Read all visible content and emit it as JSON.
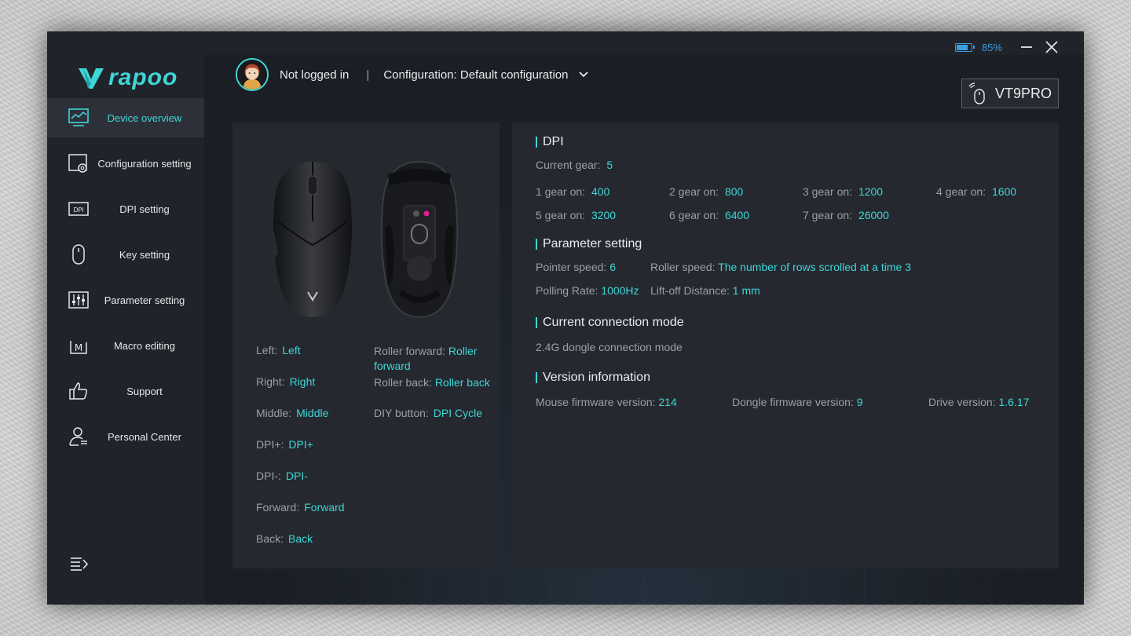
{
  "app": {
    "logo_text": "rapoo",
    "battery": "85%",
    "battery_level": 0.85,
    "accent_color": "#3ed6d6"
  },
  "sidebar": {
    "items": [
      {
        "label": "Device overview",
        "icon": "monitor-chart-icon",
        "active": true
      },
      {
        "label": "Configuration setting",
        "icon": "config-gear-icon"
      },
      {
        "label": "DPI setting",
        "icon": "dpi-icon"
      },
      {
        "label": "Key setting",
        "icon": "mouse-icon"
      },
      {
        "label": "Parameter setting",
        "icon": "sliders-icon"
      },
      {
        "label": "Macro editing",
        "icon": "macro-icon"
      },
      {
        "label": "Support",
        "icon": "thumbs-up-icon"
      },
      {
        "label": "Personal Center",
        "icon": "user-icon"
      }
    ]
  },
  "header": {
    "user_status": "Not logged in",
    "separator": "|",
    "configuration": "Configuration: Default configuration",
    "device_name": "VT9PRO"
  },
  "keys": {
    "left": {
      "label": "Left:",
      "value": "Left"
    },
    "right": {
      "label": "Right:",
      "value": "Right"
    },
    "middle": {
      "label": "Middle:",
      "value": "Middle"
    },
    "dpi_plus": {
      "label": "DPI+:",
      "value": "DPI+"
    },
    "dpi_minus": {
      "label": "DPI-:",
      "value": "DPI-"
    },
    "forward": {
      "label": "Forward:",
      "value": "Forward"
    },
    "back": {
      "label": "Back:",
      "value": "Back"
    },
    "roller_forward": {
      "label": "Roller forward:",
      "value": "Roller forward"
    },
    "roller_back": {
      "label": "Roller back:",
      "value": "Roller back"
    },
    "diy_button": {
      "label": "DIY button:",
      "value": "DPI Cycle"
    }
  },
  "dpi": {
    "title": "DPI",
    "current_gear_label": "Current gear:",
    "current_gear": "5",
    "gears": [
      {
        "label": "1 gear on:",
        "value": "400"
      },
      {
        "label": "2 gear on:",
        "value": "800"
      },
      {
        "label": "3 gear on:",
        "value": "1200"
      },
      {
        "label": "4 gear on:",
        "value": "1600"
      },
      {
        "label": "5 gear on:",
        "value": "3200"
      },
      {
        "label": "6 gear on:",
        "value": "6400"
      },
      {
        "label": "7 gear on:",
        "value": "26000"
      }
    ]
  },
  "parameters": {
    "title": "Parameter setting",
    "pointer_speed_label": "Pointer speed:",
    "pointer_speed": "6",
    "roller_speed_label": "Roller speed:",
    "roller_speed": "The number of rows scrolled at a time 3",
    "polling_rate_label": "Polling Rate:",
    "polling_rate": "1000Hz",
    "lift_off_label": "Lift-off Distance:",
    "lift_off": "1 mm"
  },
  "connection": {
    "title": "Current connection mode",
    "mode": "2.4G dongle connection mode"
  },
  "version": {
    "title": "Version information",
    "mouse_fw_label": "Mouse firmware version:",
    "mouse_fw": "214",
    "dongle_fw_label": "Dongle firmware version:",
    "dongle_fw": "9",
    "drive_label": "Drive version:",
    "drive": "1.6.17"
  }
}
